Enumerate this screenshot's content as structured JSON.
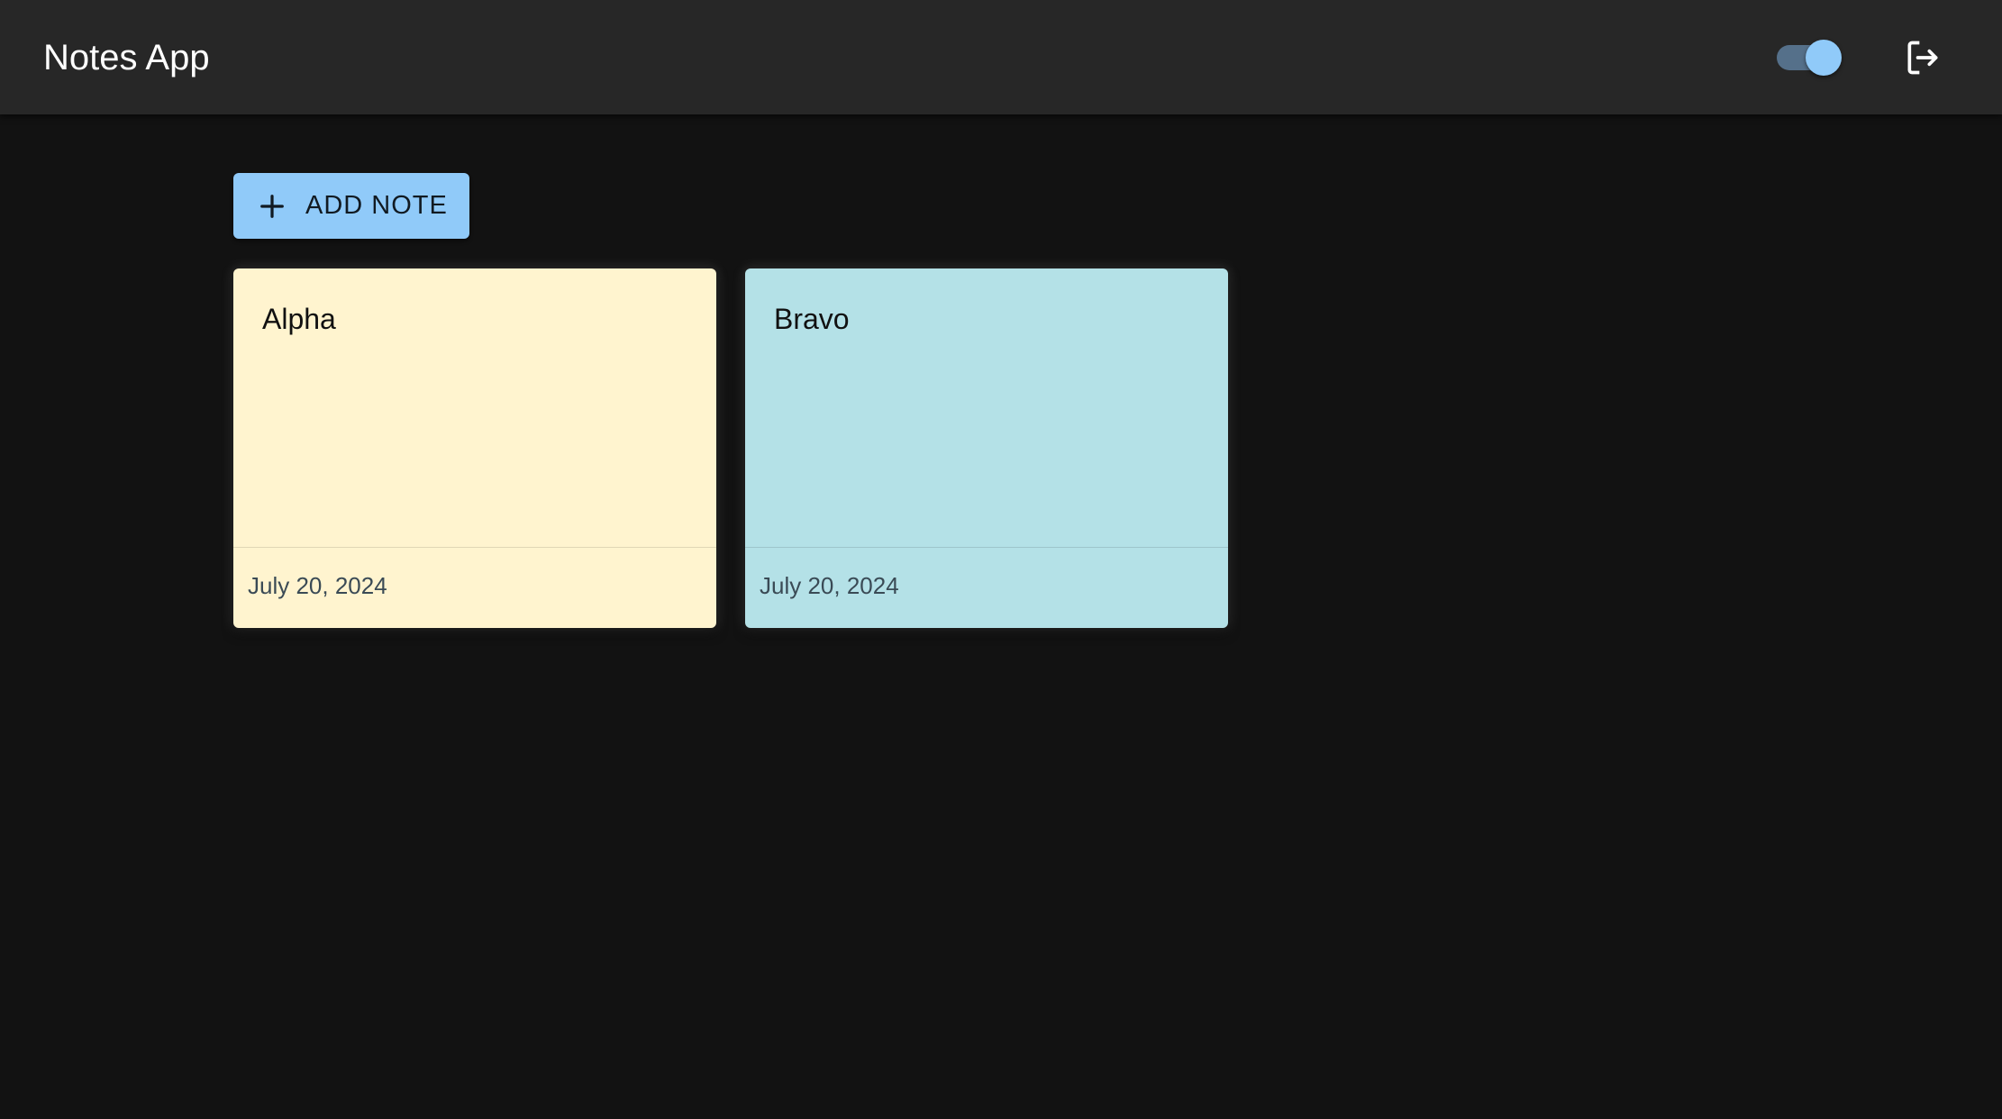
{
  "app_bar": {
    "title": "Notes App",
    "theme_toggle": {
      "checked": true,
      "track_color": "#55708a",
      "thumb_color": "#90caf9"
    },
    "logout_icon": "logout-icon"
  },
  "toolbar": {
    "add_icon": "plus-icon",
    "add_note_label": "ADD NOTE",
    "accent_color": "#90caf9"
  },
  "notes": [
    {
      "title": "Alpha",
      "date": "July 20, 2024",
      "color": "#fff4cf"
    },
    {
      "title": "Bravo",
      "date": "July 20, 2024",
      "color": "#b4e1e7"
    }
  ]
}
